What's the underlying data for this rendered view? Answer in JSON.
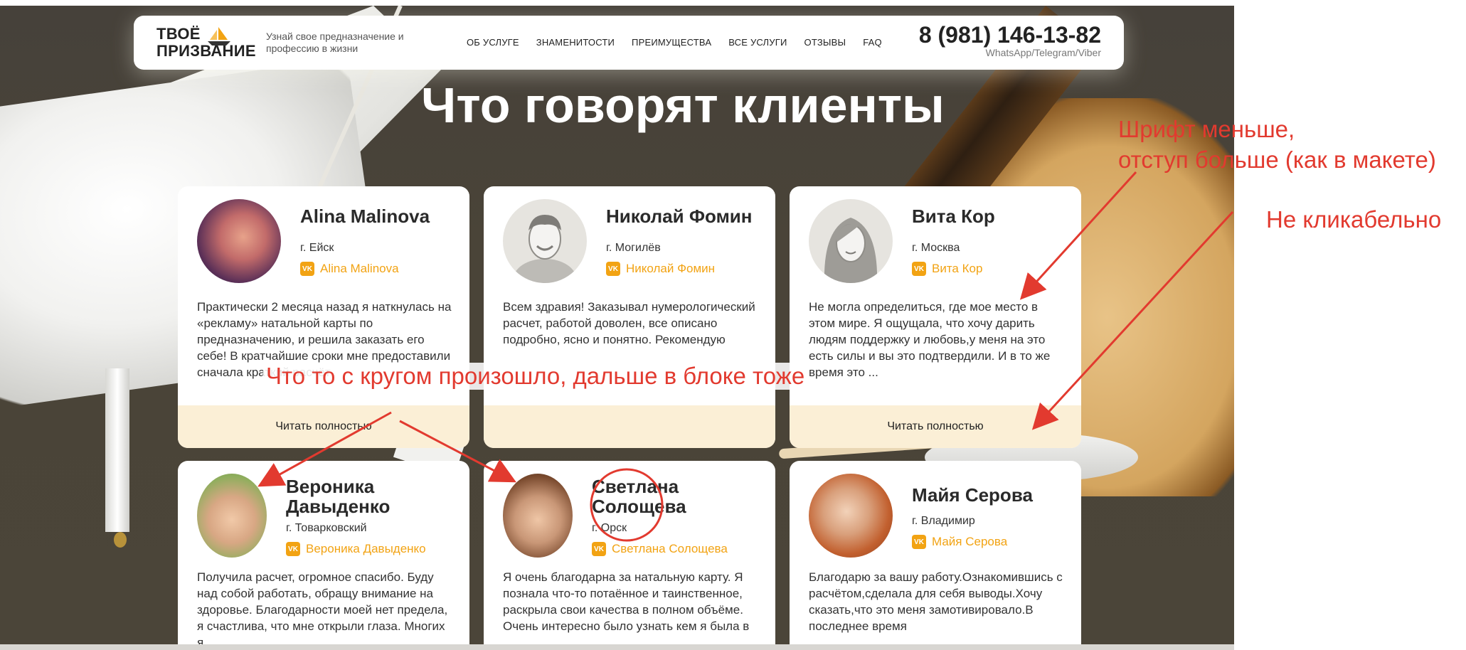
{
  "header": {
    "logo_line1": "ТВОЁ",
    "logo_line2": "ПРИЗВАНИЕ",
    "tagline": "Узнай свое предназначение и профессию в жизни",
    "nav": [
      "ОБ УСЛУГЕ",
      "ЗНАМЕНИТОСТИ",
      "ПРЕИМУЩЕСТВА",
      "ВСЕ УСЛУГИ",
      "ОТЗЫВЫ",
      "FAQ"
    ],
    "phone": "8 (981) 146-13-82",
    "messengers": "WhatsApp/Telegram/Viber"
  },
  "section": {
    "title": "Что говорят клиенты"
  },
  "reviews": [
    {
      "name": "Alina Malinova",
      "city": "г. Ейск",
      "vk": "Alina Malinova",
      "text": "Практически 2 месяца назад я наткнулась на «рекламу» натальной карты по предназначению, и решила заказать его себе! В кратчайшие сроки мне предоставили сначала краткий расчёт",
      "more": "Читать полностью"
    },
    {
      "name": "Николай Фомин",
      "city": "г. Могилёв",
      "vk": "Николай Фомин",
      "text": "Всем здравия! Заказывал нумерологический расчет, работой доволен, все описано подробно, ясно и понятно. Рекомендую",
      "more": ""
    },
    {
      "name": "Вита Кор",
      "city": "г. Москва",
      "vk": "Вита Кор",
      "text": "Не могла определиться, где мое место в этом мире. Я ощущала, что хочу дарить людям поддержку и любовь,у меня на это есть силы и вы это подтвердили. И в то же время это ...",
      "more": "Читать полностью"
    },
    {
      "name": "Вероника Давыденко",
      "city": "г. Товарковский",
      "vk": "Вероника Давыденко",
      "text": "Получила расчет, огромное спасибо. Буду над собой работать, обращу внимание на здоровье. Благодарности моей нет предела, я счастлива, что мне открыли глаза. Многих я",
      "more": ""
    },
    {
      "name": "Светлана Солощева",
      "city": "г. Орск",
      "vk": "Светлана Солощева",
      "text": "Я очень благодарна за натальную карту. Я познала что-то потаённое и таинственное, раскрыла свои качества в полном объёме. Очень интересно было узнать кем я была в",
      "more": ""
    },
    {
      "name": "Майя Серова",
      "city": "г. Владимир",
      "vk": "Майя Серова",
      "text": "Благодарю за вашу работу.Ознакомившись с расчётом,сделала для себя выводы.Хочу сказать,что это меня замотивировало.В последнее время",
      "more": ""
    }
  ],
  "annotations": {
    "font": "Шрифт меньше,\nотступ больше (как в макете)",
    "font_line1": "Шрифт меньше,",
    "font_line2": "отступ больше (как в макете)",
    "not_clickable": "Не кликабельно",
    "circle": "Что то с кругом произошло, дальше в блоке тоже"
  },
  "colors": {
    "accent": "#f2a313",
    "annotation": "#e23a2f",
    "readmore_bg": "#fbefd6",
    "site_bg": "#48423a"
  }
}
